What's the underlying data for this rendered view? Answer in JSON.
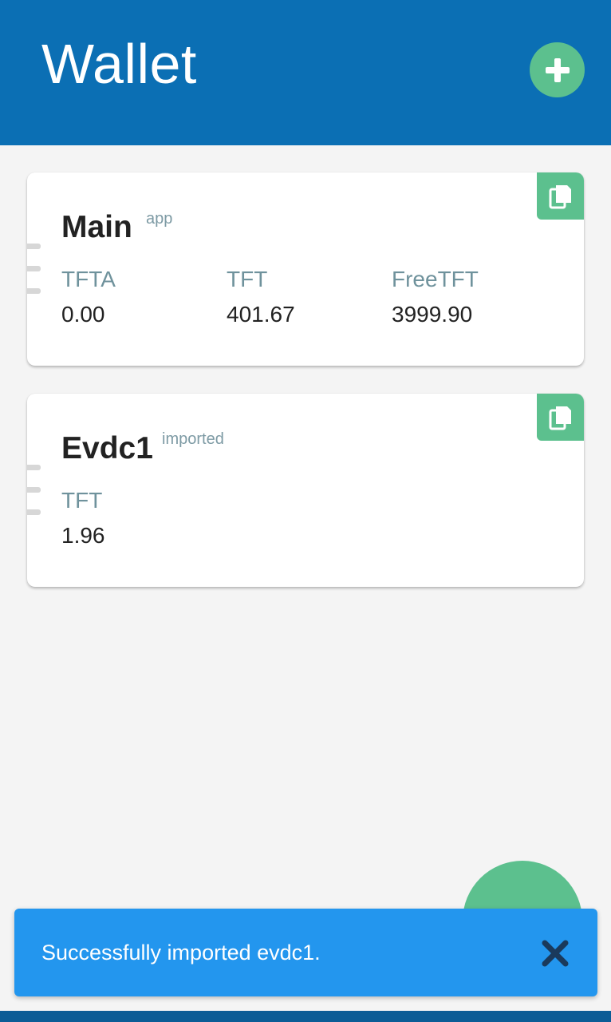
{
  "header": {
    "title": "Wallet",
    "add_icon": "plus-icon"
  },
  "wallets": [
    {
      "name": "Main",
      "tag": "app",
      "balances": [
        {
          "label": "TFTA",
          "value": "0.00"
        },
        {
          "label": "TFT",
          "value": "401.67"
        },
        {
          "label": "FreeTFT",
          "value": "3999.90"
        }
      ]
    },
    {
      "name": "Evdc1",
      "tag": "imported",
      "balances": [
        {
          "label": "TFT",
          "value": "1.96"
        }
      ]
    }
  ],
  "snackbar": {
    "message": "Successfully imported evdc1.",
    "close_icon": "close-icon"
  },
  "colors": {
    "header": "#0b6fb4",
    "accent_green": "#5cc08e",
    "snackbar": "#2396ee",
    "background": "#f4f4f4"
  }
}
